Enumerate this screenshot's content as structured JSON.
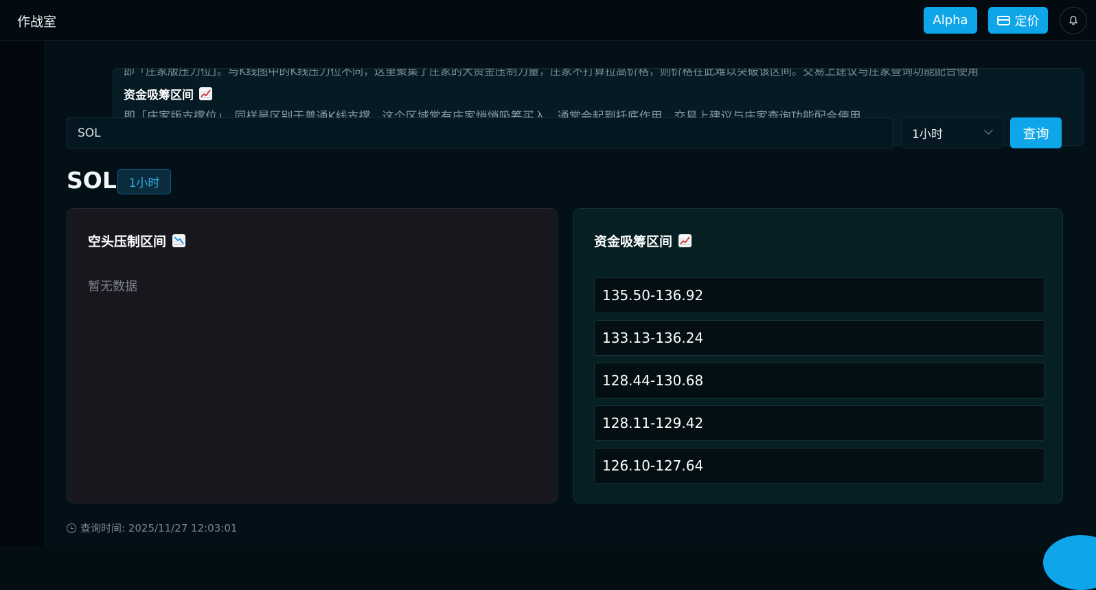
{
  "header": {
    "title": "作战室",
    "alpha_label": "Alpha",
    "pricing_label": "定价"
  },
  "info": {
    "cut_line": "即「庄家版压力位」。与K线图中的K线压力位不同，这里聚集了庄家的大资金压制力量，庄家不打算拉高价格，则价格在此难以突破该区间。交易上建议与庄家查询功能配合使用",
    "heading": "资金吸筹区间",
    "description": "即「庄家版支撑位」，同样是区别于普通K线支撑。这个区域常有庄家悄悄吸筹买入，通常会起到托底作用。交易上建议与庄家查询功能配合使用"
  },
  "search": {
    "value": "SOL",
    "timeframe": "1小时",
    "query_label": "查询"
  },
  "result": {
    "symbol": "SOL",
    "timeframe_badge": "1小时",
    "bear_title": "空头压制区间",
    "bear_empty": "暂无数据",
    "bull_title": "资金吸筹区间",
    "bull_ranges": [
      "135.50-136.92",
      "133.13-136.24",
      "128.44-130.68",
      "128.11-129.42",
      "126.10-127.64"
    ]
  },
  "footer": {
    "query_time": "查询时间: 2025/11/27 12:03:01"
  },
  "colors": {
    "accent": "#0ea5e9",
    "background": "#041017",
    "bear_panel": "#17171d",
    "bull_panel": "#051f22",
    "chart_up": "#d32f2f",
    "chart_down": "#1e88e5"
  },
  "icons": {
    "bear": "chart-decreasing-icon",
    "bull": "chart-increasing-icon",
    "pricing": "credit-card-icon",
    "notify": "bell-icon",
    "time": "clock-icon"
  }
}
